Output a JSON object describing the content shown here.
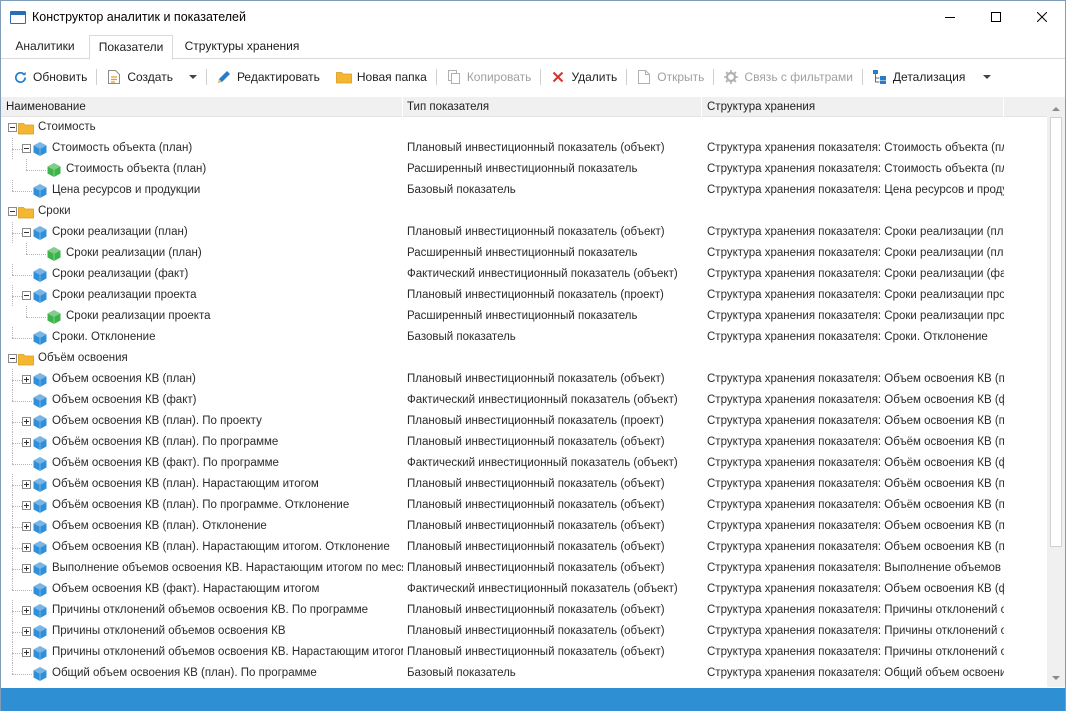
{
  "window": {
    "title": "Конструктор аналитик и показателей"
  },
  "tabs": [
    {
      "label": "Аналитики",
      "active": false
    },
    {
      "label": "Показатели",
      "active": true
    },
    {
      "label": "Структуры хранения",
      "active": false
    }
  ],
  "toolbar": {
    "refresh": "Обновить",
    "create": "Создать",
    "edit": "Редактировать",
    "new_folder": "Новая папка",
    "copy": "Копировать",
    "delete": "Удалить",
    "open": "Открыть",
    "filter_link": "Связь с фильтрами",
    "detail": "Детализация"
  },
  "columns": [
    "Наименование",
    "Тип показателя",
    "Структура хранения"
  ],
  "rows": [
    {
      "level": 0,
      "kind": "folder",
      "exp": "minus",
      "name": "Стоимость",
      "type": "",
      "storage": ""
    },
    {
      "level": 1,
      "kind": "blue",
      "exp": "minus",
      "name": "Стоимость объекта (план)",
      "type": "Плановый инвестиционный показатель (объект)",
      "storage": "Структура хранения показателя: Стоимость объекта (пла"
    },
    {
      "level": 2,
      "kind": "green",
      "exp": "none",
      "name": "Стоимость объекта (план)",
      "type": "Расширенный инвестиционный показатель",
      "storage": "Структура хранения показателя: Стоимость объекта (пла"
    },
    {
      "level": 1,
      "kind": "blue",
      "exp": "none",
      "name": "Цена ресурсов и продукции",
      "type": "Базовый показатель",
      "storage": "Структура хранения показателя: Цена ресурсов и продук"
    },
    {
      "level": 0,
      "kind": "folder",
      "exp": "minus",
      "name": "Сроки",
      "type": "",
      "storage": ""
    },
    {
      "level": 1,
      "kind": "blue",
      "exp": "minus",
      "name": "Сроки реализации (план)",
      "type": "Плановый инвестиционный показатель (объект)",
      "storage": "Структура хранения показателя: Сроки реализации (план"
    },
    {
      "level": 2,
      "kind": "green",
      "exp": "none",
      "name": "Сроки реализации (план)",
      "type": "Расширенный инвестиционный показатель",
      "storage": "Структура хранения показателя: Сроки реализации (план"
    },
    {
      "level": 1,
      "kind": "blue",
      "exp": "none",
      "name": "Сроки реализации (факт)",
      "type": "Фактический инвестиционный показатель (объект)",
      "storage": "Структура хранения показателя: Сроки реализации (факт"
    },
    {
      "level": 1,
      "kind": "blue",
      "exp": "minus",
      "name": "Сроки реализации проекта",
      "type": "Плановый инвестиционный показатель (проект)",
      "storage": "Структура хранения показателя: Сроки реализации проек"
    },
    {
      "level": 2,
      "kind": "green",
      "exp": "none",
      "name": "Сроки реализации проекта",
      "type": "Расширенный инвестиционный показатель",
      "storage": "Структура хранения показателя: Сроки реализации проек"
    },
    {
      "level": 1,
      "kind": "blue",
      "exp": "none",
      "name": "Сроки. Отклонение",
      "type": "Базовый показатель",
      "storage": "Структура хранения показателя: Сроки. Отклонение"
    },
    {
      "level": 0,
      "kind": "folder",
      "exp": "minus",
      "name": "Объём освоения",
      "type": "",
      "storage": ""
    },
    {
      "level": 1,
      "kind": "blue",
      "exp": "plus",
      "name": "Объем освоения КВ (план)",
      "type": "Плановый инвестиционный показатель (объект)",
      "storage": "Структура хранения показателя: Объем освоения КВ (пл"
    },
    {
      "level": 1,
      "kind": "blue",
      "exp": "none",
      "name": "Объем освоения КВ (факт)",
      "type": "Фактический инвестиционный показатель (объект)",
      "storage": "Структура хранения показателя: Объем освоения КВ (фа"
    },
    {
      "level": 1,
      "kind": "blue",
      "exp": "plus",
      "name": "Объем освоения КВ (план). По проекту",
      "type": "Плановый инвестиционный показатель (проект)",
      "storage": "Структура хранения показателя: Объем освоения КВ (пл"
    },
    {
      "level": 1,
      "kind": "blue",
      "exp": "plus",
      "name": "Объём освоения КВ (план). По программе",
      "type": "Плановый инвестиционный показатель (объект)",
      "storage": "Структура хранения показателя: Объём освоения КВ (пл"
    },
    {
      "level": 1,
      "kind": "blue",
      "exp": "none",
      "name": "Объём освоения КВ (факт). По программе",
      "type": "Фактический инвестиционный показатель (объект)",
      "storage": "Структура хранения показателя: Объём освоения КВ (фа"
    },
    {
      "level": 1,
      "kind": "blue",
      "exp": "plus",
      "name": "Объём освоения КВ (план). Нарастающим итогом",
      "type": "Плановый инвестиционный показатель (объект)",
      "storage": "Структура хранения показателя: Объём освоения КВ (пл"
    },
    {
      "level": 1,
      "kind": "blue",
      "exp": "plus",
      "name": "Объём освоения КВ (план). По программе. Отклонение",
      "type": "Плановый инвестиционный показатель (объект)",
      "storage": "Структура хранения показателя: Объём освоения КВ (пл"
    },
    {
      "level": 1,
      "kind": "blue",
      "exp": "plus",
      "name": "Объем освоения КВ (план). Отклонение",
      "type": "Плановый инвестиционный показатель (объект)",
      "storage": "Структура хранения показателя: Объем освоения КВ (пл"
    },
    {
      "level": 1,
      "kind": "blue",
      "exp": "plus",
      "name": "Объем освоения КВ (план). Нарастающим итогом. Отклонение",
      "type": "Плановый инвестиционный показатель (объект)",
      "storage": "Структура хранения показателя: Объем освоения КВ (пл"
    },
    {
      "level": 1,
      "kind": "blue",
      "exp": "plus",
      "name": "Выполнение объемов освоения КВ. Нарастающим итогом по месяца",
      "type": "Плановый инвестиционный показатель (объект)",
      "storage": "Структура хранения показателя: Выполнение объемов ос"
    },
    {
      "level": 1,
      "kind": "blue",
      "exp": "none",
      "name": "Объем освоения КВ (факт). Нарастающим итогом",
      "type": "Фактический инвестиционный показатель (объект)",
      "storage": "Структура хранения показателя: Объем освоения КВ (фа"
    },
    {
      "level": 1,
      "kind": "blue",
      "exp": "plus",
      "name": "Причины отклонений объемов освоения КВ. По программе",
      "type": "Плановый инвестиционный показатель (объект)",
      "storage": "Структура хранения показателя: Причины отклонений об"
    },
    {
      "level": 1,
      "kind": "blue",
      "exp": "plus",
      "name": "Причины отклонений объемов освоения КВ",
      "type": "Плановый инвестиционный показатель (объект)",
      "storage": "Структура хранения показателя: Причины отклонений об"
    },
    {
      "level": 1,
      "kind": "blue",
      "exp": "plus",
      "name": "Причины отклонений объемов освоения КВ. Нарастающим итогом",
      "type": "Плановый инвестиционный показатель (объект)",
      "storage": "Структура хранения показателя: Причины отклонений об"
    },
    {
      "level": 1,
      "kind": "blue",
      "exp": "none",
      "name": "Общий объем освоения КВ (план). По программе",
      "type": "Базовый показатель",
      "storage": "Структура хранения показателя: Общий объем освоения"
    }
  ],
  "colors": {
    "status_bar": "#2e8fd2",
    "folder": "#f5b731",
    "cube_blue": "#2f8fd8",
    "cube_green": "#3cb44b"
  }
}
